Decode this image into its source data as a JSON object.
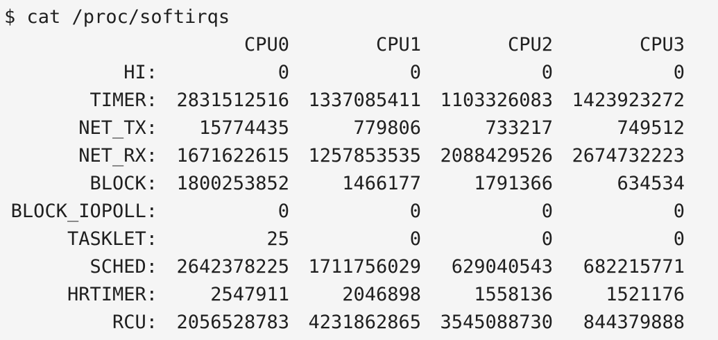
{
  "prompt": {
    "symbol": "$",
    "command": "cat /proc/softirqs"
  },
  "headers": [
    "CPU0",
    "CPU1",
    "CPU2",
    "CPU3"
  ],
  "rows": [
    {
      "label": "HI:",
      "values": [
        "0",
        "0",
        "0",
        "0"
      ]
    },
    {
      "label": "TIMER:",
      "values": [
        "2831512516",
        "1337085411",
        "1103326083",
        "1423923272"
      ]
    },
    {
      "label": "NET_TX:",
      "values": [
        "15774435",
        "779806",
        "733217",
        "749512"
      ]
    },
    {
      "label": "NET_RX:",
      "values": [
        "1671622615",
        "1257853535",
        "2088429526",
        "2674732223"
      ]
    },
    {
      "label": "BLOCK:",
      "values": [
        "1800253852",
        "1466177",
        "1791366",
        "634534"
      ]
    },
    {
      "label": "BLOCK_IOPOLL:",
      "values": [
        "0",
        "0",
        "0",
        "0"
      ]
    },
    {
      "label": "TASKLET:",
      "values": [
        "25",
        "0",
        "0",
        "0"
      ]
    },
    {
      "label": "SCHED:",
      "values": [
        "2642378225",
        "1711756029",
        "629040543",
        "682215771"
      ]
    },
    {
      "label": "HRTIMER:",
      "values": [
        "2547911",
        "2046898",
        "1558136",
        "1521176"
      ]
    },
    {
      "label": "RCU:",
      "values": [
        "2056528783",
        "4231862865",
        "3545088730",
        "844379888"
      ]
    }
  ],
  "colors": {
    "background": "#f5f5f5",
    "text": "#1f1f1f"
  }
}
